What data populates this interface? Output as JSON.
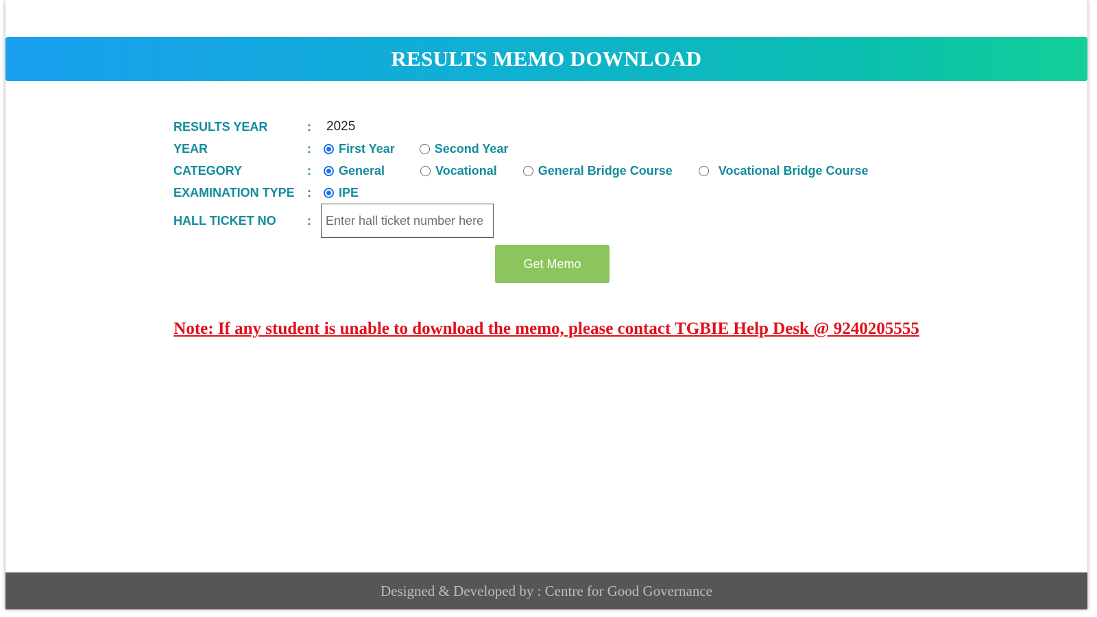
{
  "header": {
    "title": "RESULTS MEMO DOWNLOAD"
  },
  "form": {
    "colon": ":",
    "results_year": {
      "label": "RESULTS YEAR",
      "value": "2025"
    },
    "year": {
      "label": "YEAR",
      "options": [
        "First Year",
        "Second Year"
      ],
      "selected": "First Year"
    },
    "category": {
      "label": "CATEGORY",
      "options": [
        "General",
        "Vocational",
        "General Bridge Course",
        "Vocational Bridge Course"
      ],
      "selected": "General"
    },
    "exam_type": {
      "label": "EXAMINATION TYPE",
      "options": [
        "IPE"
      ],
      "selected": "IPE"
    },
    "hall_ticket": {
      "label": "HALL TICKET NO",
      "placeholder": "Enter hall ticket number here",
      "value": ""
    },
    "submit_label": "Get Memo"
  },
  "note": {
    "text": "Note: If any student is unable to download the memo, please contact TGBIE Help Desk @ 9240205555"
  },
  "footer": {
    "text": "Designed & Developed by : Centre for Good Governance"
  },
  "colors": {
    "label": "#138c9c",
    "button": "#8dc45e",
    "note": "#e0101a",
    "footer_bg": "#565656",
    "radio_selected": "#1a73e8"
  }
}
